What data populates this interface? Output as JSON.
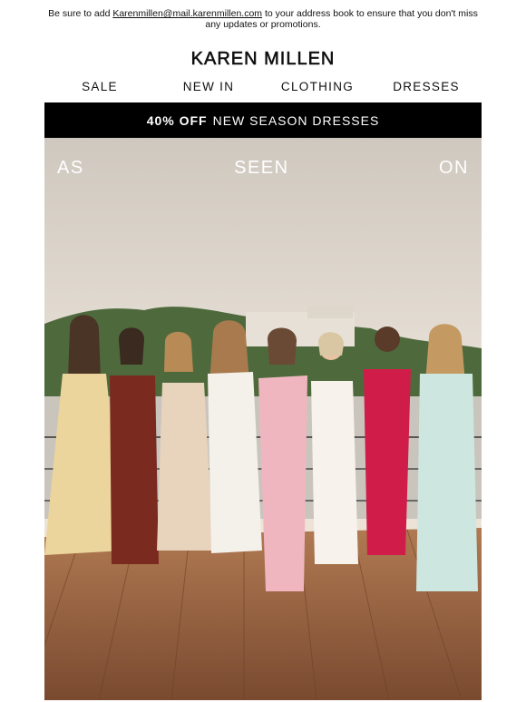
{
  "preheader": {
    "before": "Be sure to add ",
    "email": "Karenmillen@mail.karenmillen.com",
    "after": " to your address book to ensure that you don't miss any updates or promotions."
  },
  "brand": {
    "logo": "KAREN MILLEN"
  },
  "nav": {
    "items": [
      {
        "label": "SALE"
      },
      {
        "label": "NEW IN"
      },
      {
        "label": "CLOTHING"
      },
      {
        "label": "DRESSES"
      }
    ]
  },
  "promo": {
    "bold": "40% OFF",
    "text": "NEW SEASON DRESSES"
  },
  "hero": {
    "words": [
      "AS",
      "SEEN",
      "ON"
    ],
    "image": "group-photo-women-on-dock",
    "colors": {
      "sky": "#e9e2d6",
      "deck": "#9a6442",
      "hill": "#4e6a3d"
    }
  }
}
